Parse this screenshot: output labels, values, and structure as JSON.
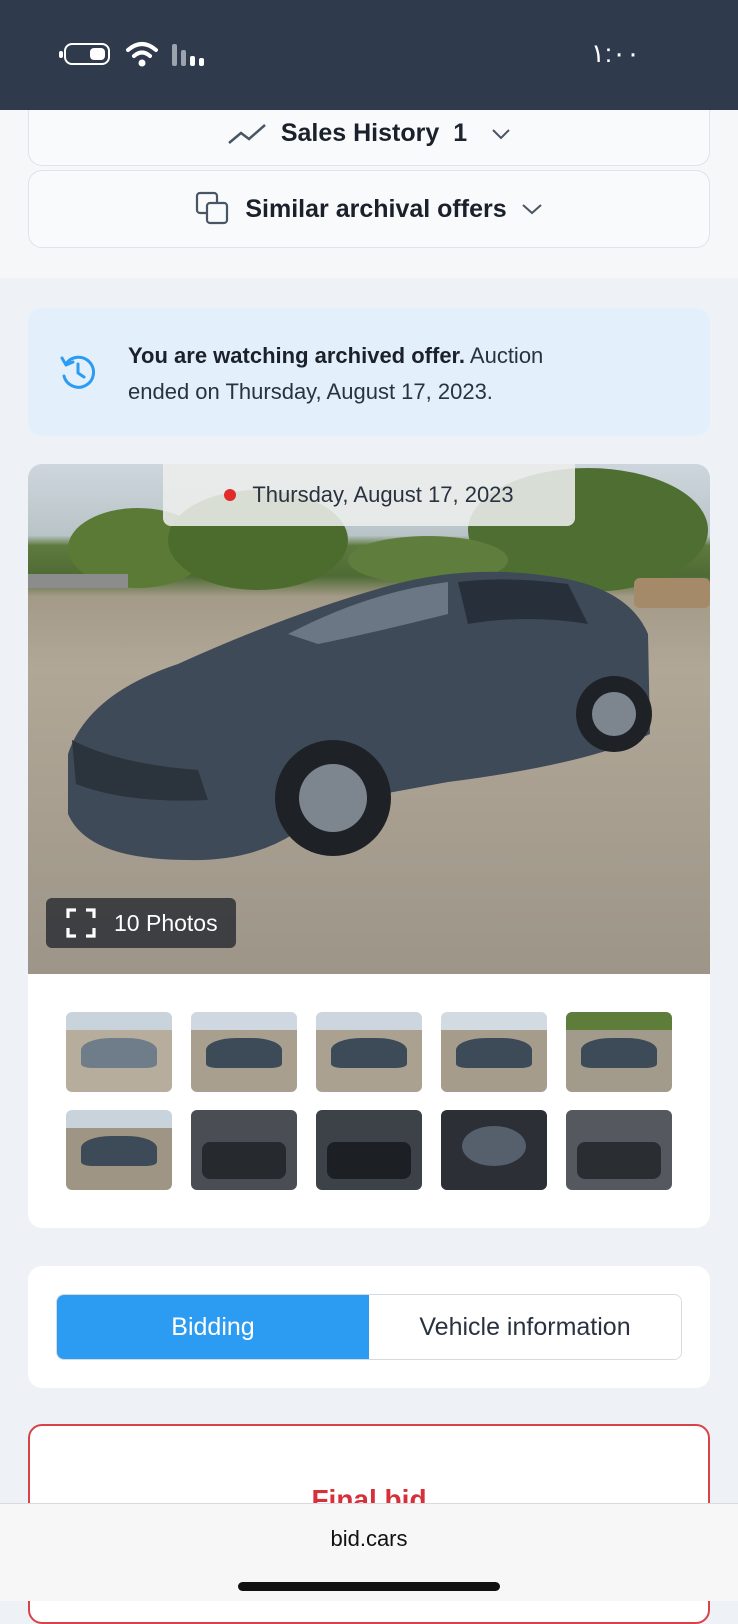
{
  "status_bar": {
    "time": "١:٠٠"
  },
  "sections": {
    "sales_history": {
      "label": "Sales History",
      "count": "1"
    },
    "similar_offers": {
      "label": "Similar archival offers"
    }
  },
  "notice": {
    "bold_text": "You are watching archived offer.",
    "text": " Auction ended on Thursday, August 17, 2023."
  },
  "gallery": {
    "date_label": "Thursday, August 17, 2023",
    "photos_label": "10 Photos",
    "thumbnail_count": 10
  },
  "tabs": [
    {
      "label": "Bidding",
      "active": true
    },
    {
      "label": "Vehicle information",
      "active": false
    }
  ],
  "final_bid": {
    "label": "Final bid"
  },
  "browser": {
    "url": "bid.cars"
  },
  "colors": {
    "status_bar": "#2f3b4d",
    "accent_blue": "#2b9cf2",
    "final_bid_red": "#d8303a",
    "notice_background": "#e3f0fb"
  }
}
